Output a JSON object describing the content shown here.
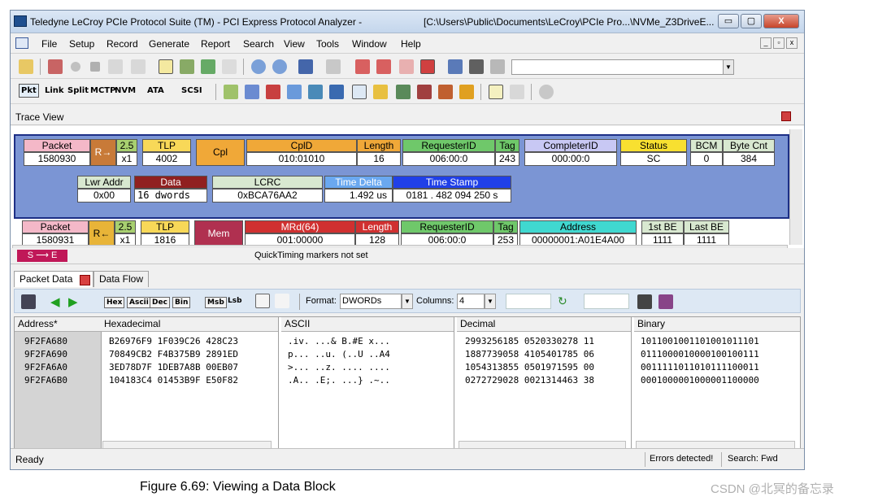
{
  "window": {
    "title": "Teledyne LeCroy PCIe Protocol Suite (TM) - PCI Express Protocol Analyzer -",
    "path": "[C:\\Users\\Public\\Documents\\LeCroy\\PCIe Pro...\\NVMe_Z3DriveE...",
    "minimize": "▭",
    "maximize": "▢",
    "close": "X"
  },
  "menu": [
    "File",
    "Setup",
    "Record",
    "Generate",
    "Report",
    "Search",
    "View",
    "Tools",
    "Window",
    "Help"
  ],
  "toolbar2": {
    "pkt": "Pkt",
    "link": "Link",
    "split": "Split",
    "mctp": "MCTP",
    "nvm": "NVM",
    "ata": "ATA",
    "scsi": "SCSI"
  },
  "trace_view": {
    "title": "Trace View"
  },
  "packet1": {
    "hdr_packet": "Packet",
    "packet": "1580930",
    "dir": "R→",
    "speed": "2.5",
    "lanes": "x1",
    "hdr_tlp": "TLP",
    "tlp": "4002",
    "type": "Cpl",
    "hdr_cplid": "CplD",
    "cplid": "010:01010",
    "hdr_length": "Length",
    "length": "16",
    "hdr_reqid": "RequesterID",
    "reqid": "006:00:0",
    "hdr_tag": "Tag",
    "tag": "243",
    "hdr_compid": "CompleterID",
    "compid": "000:00:0",
    "hdr_status": "Status",
    "status": "SC",
    "hdr_bcm": "BCM",
    "bcm": "0",
    "hdr_bytecnt": "Byte Cnt",
    "bytecnt": "384",
    "hdr_lwraddr": "Lwr Addr",
    "lwraddr": "0x00",
    "hdr_data": "Data",
    "data": "16 dwords",
    "hdr_lcrc": "LCRC",
    "lcrc": "0xBCA76AA2",
    "hdr_tdelta": "Time Delta",
    "tdelta": "1.492 us",
    "hdr_tstamp": "Time Stamp",
    "tstamp": "0181 . 482 094 250 s"
  },
  "packet2": {
    "hdr_packet": "Packet",
    "packet": "1580931",
    "dir": "R←",
    "speed": "2.5",
    "lanes": "x1",
    "hdr_tlp": "TLP",
    "tlp": "1816",
    "type": "Mem",
    "hdr_mrd": "MRd(64)",
    "mrd": "001:00000",
    "hdr_length": "Length",
    "length": "128",
    "hdr_reqid": "RequesterID",
    "reqid": "006:00:0",
    "hdr_tag": "Tag",
    "tag": "253",
    "hdr_address": "Address",
    "address": "00000001:A01E4A00",
    "hdr_firstbe": "1st BE",
    "firstbe": "1111",
    "hdr_lastbe": "Last BE",
    "lastbe": "1111"
  },
  "quicktiming": {
    "marker": "S ⟶ E",
    "text": "QuickTiming markers not set"
  },
  "tabs": {
    "packet_data": "Packet Data",
    "data_flow": "Data Flow"
  },
  "pd_toolbar": {
    "hex": "Hex",
    "ascii": "Ascii",
    "dec": "Dec",
    "bin": "Bin",
    "msb": "Msb",
    "lsb": "Lsb",
    "format_label": "Format:",
    "format_value": "DWORDs",
    "columns_label": "Columns:",
    "columns_value": "4"
  },
  "grid": {
    "headers": {
      "address": "Address*",
      "hex": "Hexadecimal",
      "ascii": "ASCII",
      "decimal": "Decimal",
      "binary": "Binary"
    },
    "rows": [
      {
        "address": "9F2FA680",
        "hex": "B26976F9 1F039C26 428C23",
        "ascii": ".iv. ...& B.#E x...",
        "decimal": "2993256185 0520330278 11",
        "binary": "1011001001101001011101"
      },
      {
        "address": "9F2FA690",
        "hex": "70849CB2 F4B375B9 2891ED",
        "ascii": "p... ..u. (..U ..A4",
        "decimal": "1887739058 4105401785 06",
        "binary": "0111000010000100100111"
      },
      {
        "address": "9F2FA6A0",
        "hex": "3ED78D7F 1DEB7A8B 00EB07",
        "ascii": ">... ..z. .... ....",
        "decimal": "1054313855 0501971595 00",
        "binary": "0011111011010111100011"
      },
      {
        "address": "9F2FA6B0",
        "hex": "104183C4 01453B9F E50F82",
        "ascii": ".A.. .E;. ...} .~..",
        "decimal": "0272729028 0021314463 38",
        "binary": "0001000001000001100000"
      }
    ]
  },
  "status": {
    "ready": "Ready",
    "errors": "Errors detected!",
    "search": "Search: Fwd"
  },
  "caption": "Figure 6.69:  Viewing a Data Block",
  "watermark": "CSDN @北冥的备忘录"
}
